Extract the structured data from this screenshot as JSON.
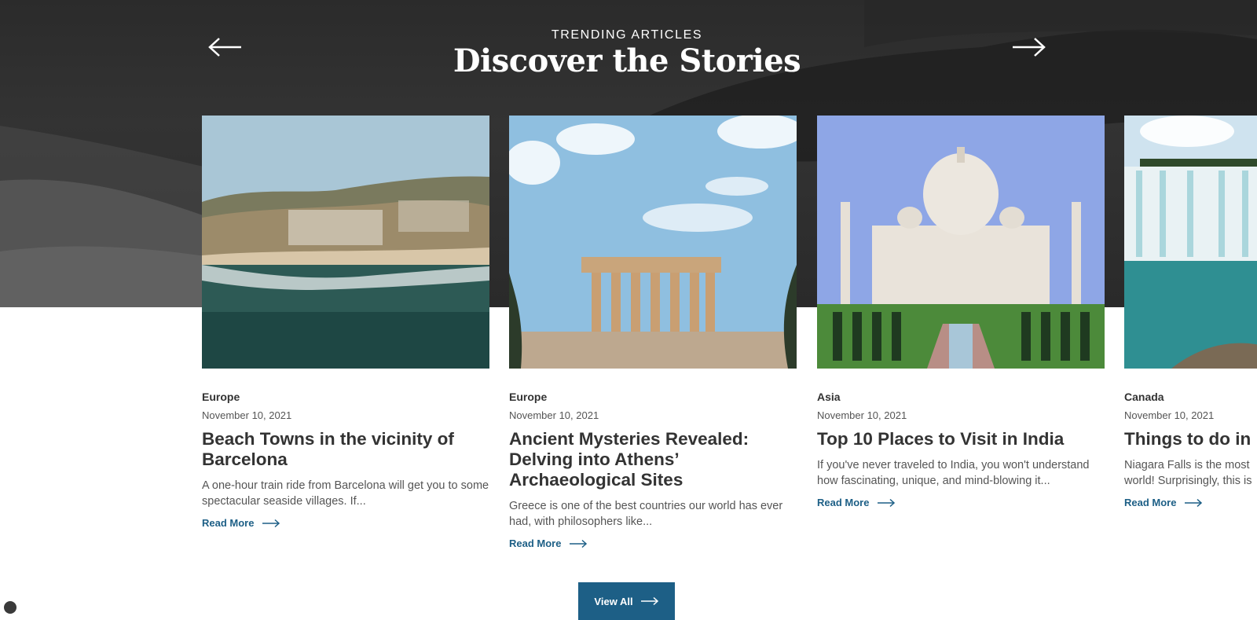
{
  "section": {
    "eyebrow": "TRENDING ARTICLES",
    "title": "Discover the Stories",
    "prev_icon": "arrow-left-icon",
    "next_icon": "arrow-right-icon"
  },
  "articles": [
    {
      "category": "Europe",
      "date": "November 10, 2021",
      "title": "Beach Towns in the vicinity of Barcelona",
      "excerpt": "A one-hour train ride from Barcelona will get you to some spectacular seaside villages. If...",
      "read_more": "Read More",
      "image": "coastal-cliff-town-photo"
    },
    {
      "category": "Europe",
      "date": "November 10, 2021",
      "title": "Ancient Mysteries Revealed: Delving into Athens’ Archaeological Sites",
      "excerpt": "Greece is one of the best countries our world has ever had, with philosophers like...",
      "read_more": "Read More",
      "image": "parthenon-photo"
    },
    {
      "category": "Asia",
      "date": "November 10, 2021",
      "title": "Top 10 Places to Visit in India",
      "excerpt": "If you've never traveled to India, you won't understand how fascinating, unique, and mind-blowing it...",
      "read_more": "Read More",
      "image": "taj-mahal-photo"
    },
    {
      "category": "Canada",
      "date": "November 10, 2021",
      "title": "Things to do in",
      "excerpt": "Niagara Falls is the most world! Surprisingly, this is",
      "read_more": "Read More",
      "image": "niagara-falls-photo"
    }
  ],
  "view_all": "View All",
  "colors": {
    "accent": "#1d5f86",
    "hero_bg": "#2e2e2e",
    "text_dark": "#333333"
  }
}
